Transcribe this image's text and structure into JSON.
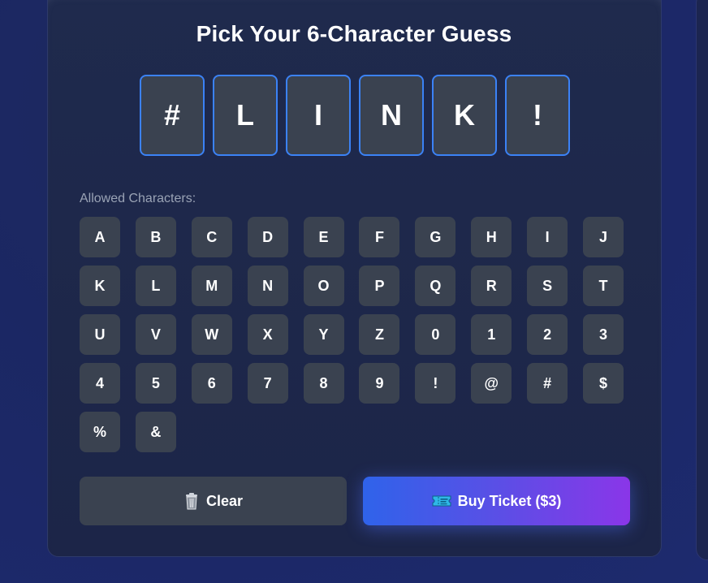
{
  "title": "Pick Your 6-Character Guess",
  "guess_slots": [
    "#",
    "L",
    "I",
    "N",
    "K",
    "!"
  ],
  "allowed_label": "Allowed Characters:",
  "allowed_characters": [
    "A",
    "B",
    "C",
    "D",
    "E",
    "F",
    "G",
    "H",
    "I",
    "J",
    "K",
    "L",
    "M",
    "N",
    "O",
    "P",
    "Q",
    "R",
    "S",
    "T",
    "U",
    "V",
    "W",
    "X",
    "Y",
    "Z",
    "0",
    "1",
    "2",
    "3",
    "4",
    "5",
    "6",
    "7",
    "8",
    "9",
    "!",
    "@",
    "#",
    "$",
    "%",
    "&"
  ],
  "buttons": {
    "clear_label": "Clear",
    "clear_icon": "trash-icon",
    "buy_label": "Buy Ticket ($3)",
    "buy_icon": "ticket-icon"
  },
  "colors": {
    "accent_border": "#3b82f6",
    "tile_bg": "#3a4250",
    "buy_gradient_start": "#2f63ea",
    "buy_gradient_end": "#8a36e8"
  }
}
